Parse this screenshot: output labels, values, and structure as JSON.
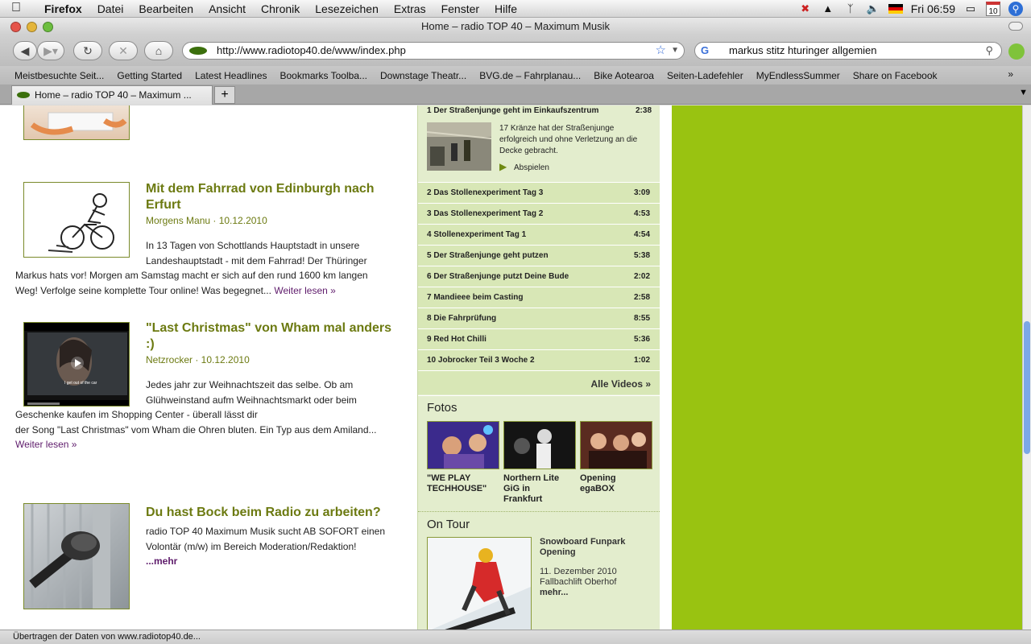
{
  "menubar": {
    "app": "Firefox",
    "items": [
      "Datei",
      "Bearbeiten",
      "Ansicht",
      "Chronik",
      "Lesezeichen",
      "Extras",
      "Fenster",
      "Hilfe"
    ],
    "clock": "Fri 06:59",
    "calendar_day": "10"
  },
  "window": {
    "title": "Home – radio TOP 40 – Maximum Musik"
  },
  "toolbar": {
    "url": "http://www.radiotop40.de/www/index.php",
    "search": "markus stitz hturinger allgemien"
  },
  "bookmarks": [
    "Meistbesuchte Seit...",
    "Getting Started",
    "Latest Headlines",
    "Bookmarks Toolba...",
    "Downstage Theatr...",
    "BVG.de – Fahrplanau...",
    "Bike Aotearoa",
    "Seiten-Ladefehler",
    "MyEndlessSummer",
    "Share on Facebook"
  ],
  "tab": {
    "label": "Home – radio TOP 40 – Maximum ..."
  },
  "articles": [
    {
      "title_line1": "Mit dem Fahrrad von Edinburgh nach",
      "title_line2": "Erfurt",
      "meta": "Morgens Manu · 10.12.2010",
      "body1": "In 13 Tagen von Schottlands Hauptstadt in unsere",
      "body2": "Landeshauptstadt - mit dem Fahrrad! Der Thüringer",
      "body3": "Markus hats vor! Morgen am Samstag macht er sich auf den rund 1600 km langen",
      "body4": "Weg! Verfolge seine komplette Tour online! Was begegnet...",
      "more": "Weiter lesen »"
    },
    {
      "title_line1": "\"Last Christmas\" von Wham mal anders",
      "title_line2": ":)",
      "meta": "Netzrocker · 10.12.2010",
      "video_caption": "I get out of the car",
      "body1": "Jedes jahr zur Weihnachtszeit das selbe. Ob am",
      "body2": "Glühweinstand aufm Weihnachtsmarkt oder beim",
      "body3": "Geschenke kaufen im Shopping Center - überall lässt dir",
      "body4": "der Song \"Last Christmas\" vom Wham die Ohren bluten. Ein Typ aus dem Amiland...",
      "more": "Weiter lesen »"
    },
    {
      "title_line1": "Du hast Bock beim Radio zu arbeiten?",
      "body1": "radio TOP 40 Maximum Musik sucht AB SOFORT einen",
      "body2": "Volontär (m/w) im Bereich Moderation/Redaktion!",
      "more": "...mehr"
    }
  ],
  "videos": {
    "first": {
      "title": "1 Der Straßenjunge geht im Einkaufszentrum",
      "duration": "2:38",
      "desc1": "17 Kränze hat der Straßenjunge",
      "desc2": "erfolgreich und ohne Verletzung an die",
      "desc3": "Decke gebracht.",
      "play": "Abspielen"
    },
    "list": [
      {
        "title": "2 Das Stollenexperiment Tag 3",
        "duration": "3:09"
      },
      {
        "title": "3 Das Stollenexperiment Tag 2",
        "duration": "4:53"
      },
      {
        "title": "4 Stollenexperiment Tag 1",
        "duration": "4:54"
      },
      {
        "title": "5 Der Straßenjunge geht putzen",
        "duration": "5:38"
      },
      {
        "title": "6 Der Straßenjunge putzt Deine Bude",
        "duration": "2:02"
      },
      {
        "title": "7 Mandieee beim Casting",
        "duration": "2:58"
      },
      {
        "title": "8 Die Fahrprüfung",
        "duration": "8:55"
      },
      {
        "title": "9 Red Hot Chilli",
        "duration": "5:36"
      },
      {
        "title": "10 Jobrocker Teil 3 Woche 2",
        "duration": "1:02"
      }
    ],
    "all": "Alle Videos »"
  },
  "fotos": {
    "heading": "Fotos",
    "items": [
      {
        "line1": "\"WE PLAY",
        "line2": "TECHHOUSE\"",
        "line3": ""
      },
      {
        "line1": "Northern Lite",
        "line2": "GiG in",
        "line3": "Frankfurt"
      },
      {
        "line1": "Opening",
        "line2": "egaBOX",
        "line3": ""
      }
    ]
  },
  "tour": {
    "heading": "On Tour",
    "title1": "Snowboard Funpark",
    "title2": "Opening",
    "date": "11. Dezember 2010",
    "place": "Fallbachlift Oberhof",
    "more": "mehr..."
  },
  "status": "Übertragen der Daten von www.radiotop40.de..."
}
